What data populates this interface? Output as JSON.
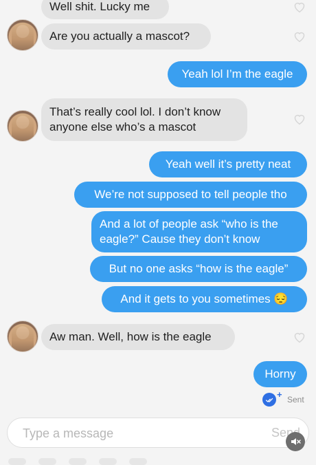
{
  "messages": [
    {
      "dir": "in",
      "text": "Well shit. Lucky me",
      "avatar": false
    },
    {
      "dir": "in",
      "text": "Are you actually a mascot?",
      "avatar": true
    },
    {
      "dir": "out",
      "text": "Yeah lol I’m the eagle"
    },
    {
      "dir": "in",
      "text": "That’s really cool lol. I don’t know\nanyone else who’s a mascot",
      "avatar": true
    },
    {
      "dir": "out",
      "text": "Yeah well it’s pretty neat"
    },
    {
      "dir": "out",
      "text": "We’re not supposed to tell people tho"
    },
    {
      "dir": "out",
      "text": "And a lot of people ask “who is the\neagle?” Cause they don’t know"
    },
    {
      "dir": "out",
      "text": "But no one asks “how is the eagle”"
    },
    {
      "dir": "out",
      "text": "And it gets to you sometimes 😔"
    },
    {
      "dir": "in",
      "text": "Aw man. Well, how is the eagle",
      "avatar": true
    },
    {
      "dir": "out",
      "text": "Horny"
    }
  ],
  "status": {
    "label": "Sent"
  },
  "composer": {
    "placeholder": "Type a message",
    "send_label": "Send"
  },
  "colors": {
    "outgoing": "#3a9ff0",
    "incoming": "#e3e3e3",
    "background": "#f4f4f4",
    "read_badge": "#2f6fe3"
  },
  "icons": {
    "like": "heart-outline-icon",
    "read": "double-check-icon",
    "mute": "speaker-muted-icon"
  }
}
